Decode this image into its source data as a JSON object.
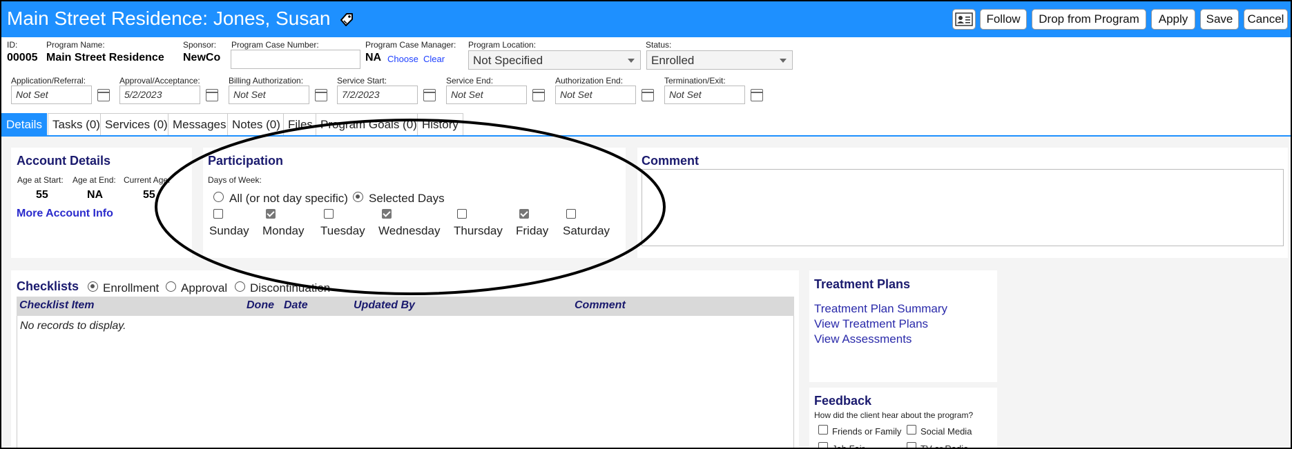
{
  "header": {
    "title": "Main Street Residence: Jones, Susan",
    "buttons": {
      "follow": "Follow",
      "drop": "Drop from Program",
      "apply": "Apply",
      "save": "Save",
      "cancel": "Cancel"
    }
  },
  "info": {
    "id_label": "ID:",
    "id_value": "00005",
    "program_name_label": "Program Name:",
    "program_name_value": "Main Street Residence",
    "sponsor_label": "Sponsor:",
    "sponsor_value": "NewCo",
    "case_number_label": "Program Case Number:",
    "case_number_value": "",
    "case_manager_label": "Program Case Manager:",
    "case_manager_value": "NA",
    "choose_link": "Choose",
    "clear_link": "Clear",
    "location_label": "Program Location:",
    "location_value": "Not Specified",
    "status_label": "Status:",
    "status_value": "Enrolled"
  },
  "dates": [
    {
      "label": "Application/Referral:",
      "value": "Not Set"
    },
    {
      "label": "Approval/Acceptance:",
      "value": "5/2/2023"
    },
    {
      "label": "Billing Authorization:",
      "value": "Not Set"
    },
    {
      "label": "Service Start:",
      "value": "7/2/2023"
    },
    {
      "label": "Service End:",
      "value": "Not Set"
    },
    {
      "label": "Authorization End:",
      "value": "Not Set"
    },
    {
      "label": "Termination/Exit:",
      "value": "Not Set"
    }
  ],
  "tabs": [
    "Details",
    "Tasks (0)",
    "Services (0)",
    "Messages",
    "Notes (0)",
    "Files",
    "Program Goals (0)",
    "History"
  ],
  "account": {
    "title": "Account Details",
    "age_start_label": "Age at Start:",
    "age_start": "55",
    "age_end_label": "Age at End:",
    "age_end": "NA",
    "current_age_label": "Current Age:",
    "current_age": "55",
    "more_link": "More Account Info"
  },
  "participation": {
    "title": "Participation",
    "days_label": "Days of Week:",
    "option_all": "All (or not day specific)",
    "option_selected": "Selected Days",
    "days": [
      {
        "name": "Sunday",
        "checked": false
      },
      {
        "name": "Monday",
        "checked": true
      },
      {
        "name": "Tuesday",
        "checked": false
      },
      {
        "name": "Wednesday",
        "checked": true
      },
      {
        "name": "Thursday",
        "checked": false
      },
      {
        "name": "Friday",
        "checked": true
      },
      {
        "name": "Saturday",
        "checked": false
      }
    ]
  },
  "comment": {
    "title": "Comment"
  },
  "checklists": {
    "title": "Checklists",
    "options": [
      "Enrollment",
      "Approval",
      "Discontinuation"
    ],
    "columns": [
      "Checklist Item",
      "Done",
      "Date",
      "Updated By",
      "Comment"
    ],
    "empty_text": "No records to display."
  },
  "treatment": {
    "title": "Treatment Plans",
    "links": [
      "Treatment Plan Summary",
      "View Treatment Plans",
      "View Assessments"
    ]
  },
  "feedback": {
    "title": "Feedback",
    "question": "How did the client hear about the program?",
    "options": [
      "Friends or Family",
      "Social Media",
      "Job Fair",
      "TV or Radio"
    ]
  }
}
